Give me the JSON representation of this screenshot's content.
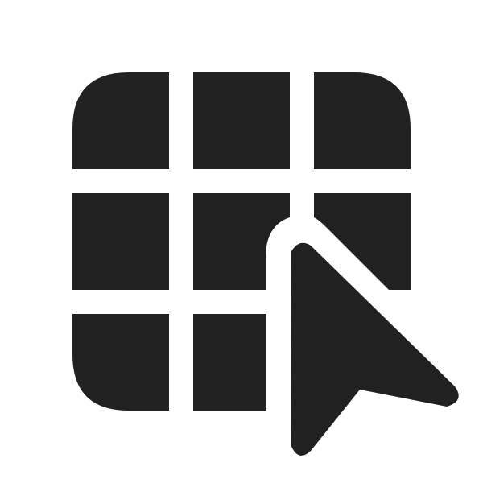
{
  "icon": {
    "name": "table-cursor-icon",
    "fill_color": "#212121",
    "background_color": "#ffffff",
    "parts": {
      "grid": "table-grid-icon",
      "cursor": "mouse-pointer-icon"
    }
  }
}
